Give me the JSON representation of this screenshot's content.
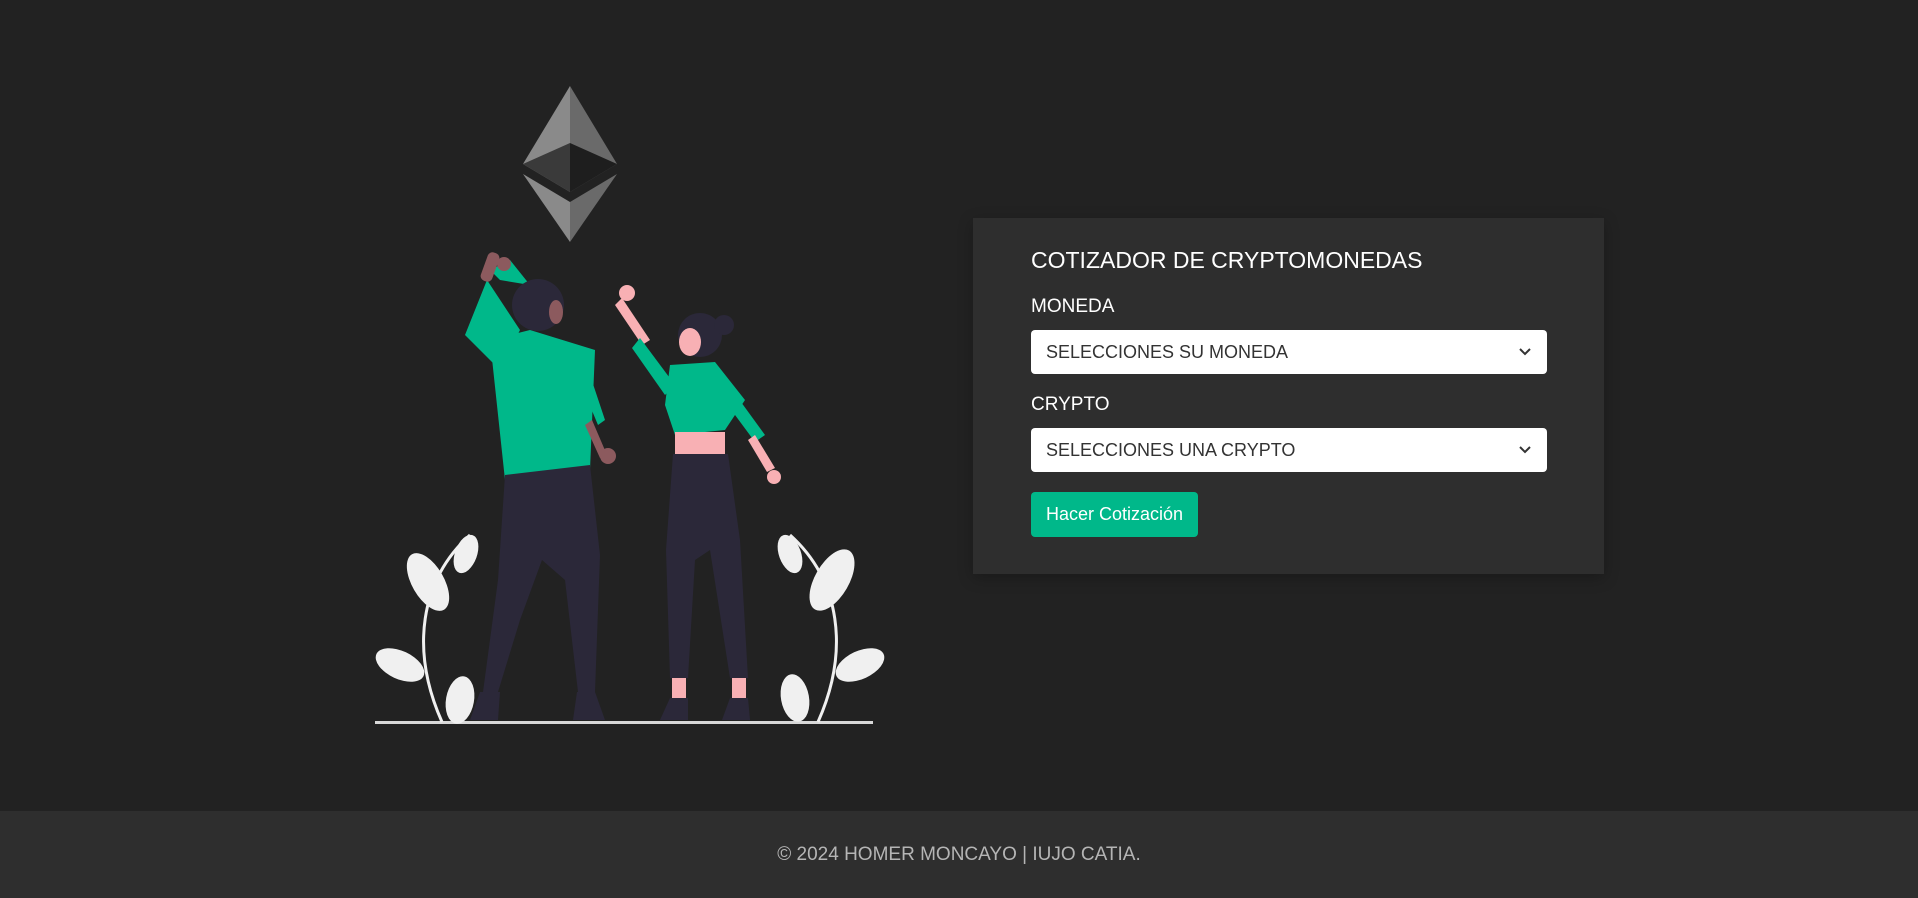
{
  "colors": {
    "background": "#222222",
    "panel": "#2e2e2e",
    "accent": "#00b88a",
    "text": "#ffffff",
    "footer_text": "#b5b5b5"
  },
  "illustration": {
    "icon": "ethereum-logo-icon"
  },
  "form": {
    "title": "COTIZADOR DE CRYPTOMONEDAS",
    "currency": {
      "label": "MONEDA",
      "selected": "SELECCIONES SU MONEDA"
    },
    "crypto": {
      "label": "CRYPTO",
      "selected": "SELECCIONES UNA CRYPTO"
    },
    "submit_label": "Hacer Cotización"
  },
  "footer": {
    "text": "© 2024 HOMER MONCAYO | IUJO CATIA."
  }
}
